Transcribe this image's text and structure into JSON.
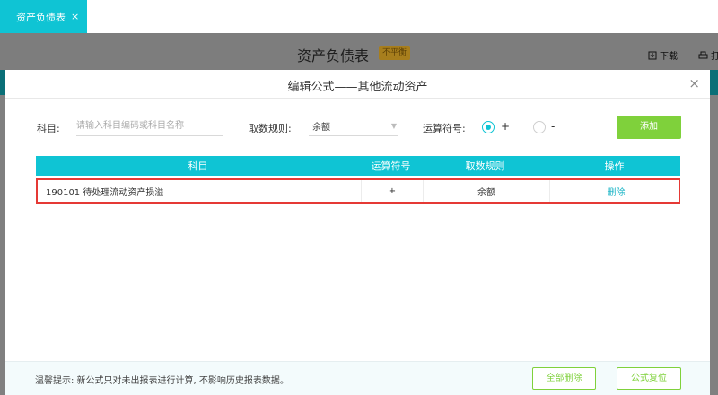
{
  "tabs": [
    {
      "label": "资产负债表",
      "close": "×"
    }
  ],
  "page": {
    "title": "资产负债表",
    "badge": "不平衡",
    "download": "下载",
    "print": "打"
  },
  "dialog": {
    "title": "编辑公式——其他流动资产",
    "close": "×",
    "form": {
      "subject_label": "科目:",
      "subject_placeholder": "请输入科目编码或科目名称",
      "rule_label": "取数规则:",
      "rule_value": "余额",
      "operator_label": "运算符号:",
      "operator_options": [
        "+",
        "-"
      ],
      "operator_selected": "+",
      "add_button": "添加"
    },
    "table": {
      "columns": [
        "科目",
        "运算符号",
        "取数规则",
        "操作"
      ],
      "rows": [
        {
          "subject": "190101 待处理流动资产损溢",
          "operator": "+",
          "rule": "余额",
          "action": "删除"
        }
      ]
    },
    "footer": {
      "tip": "温馨提示: 新公式只对未出报表进行计算, 不影响历史报表数据。",
      "delete_all": "全部删除",
      "reset": "公式复位"
    }
  },
  "colors": {
    "accent": "#0fc4d4",
    "add_button": "#7fd13b",
    "highlight": "#e53935",
    "badge": "#a77e1d"
  }
}
